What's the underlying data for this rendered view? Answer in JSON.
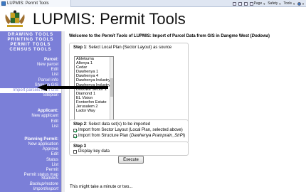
{
  "browser": {
    "tab_title": "LUPMIS: Permit Tools",
    "toolbar": [
      {
        "label": "Page",
        "icon": "page-icon"
      },
      {
        "label": "Safety",
        "icon": "safety-icon"
      },
      {
        "label": "Tools",
        "icon": "tools-icon"
      },
      {
        "label": "",
        "icon": "help-icon"
      }
    ]
  },
  "header": {
    "title": "LUPMIS: Permit Tools",
    "logo": "coat-of-arms-logo"
  },
  "sidebar": {
    "tools": [
      "Drawing Tools",
      "Printing Tools",
      "Permit Tools",
      "Census Tools"
    ],
    "sections": [
      {
        "title": "Parcel:",
        "items": [
          "New parcel",
          "Edit",
          "List",
          "Parcel info",
          "Show in GIS",
          "Import parcels from GIS",
          "Siteplan"
        ]
      },
      {
        "title": "Applicant:",
        "items": [
          "New applicant",
          "Edit",
          "List"
        ]
      },
      {
        "title": "Planning Permit:",
        "items": [
          "New application",
          "Approve",
          "Edit",
          "Status",
          "List",
          "Permit",
          "Permit status map"
        ]
      }
    ],
    "bottom_items": [
      "Statistics",
      "Backup/restore",
      "Import/export"
    ],
    "active_item": "Import parcels from GIS"
  },
  "content": {
    "welcome_prefix": "Welcome to the ",
    "welcome_em1": "Permit Tools",
    "welcome_mid": " of LUPMIS: Import of Parcel Data from GIS in Dangme West (",
    "welcome_em2": "Dodowa",
    "welcome_suffix": ")",
    "step1": {
      "label": "Step 1",
      "text": ": Select Local Plan (Sector Layout) as source",
      "options": [
        "Ablekuma",
        "Allenya 1",
        "Cedar",
        "Dawhenya 1",
        "Dawhenya 4",
        "Dawhenya Industry",
        "Dawhenya Industry",
        "Dodowa Sector 1",
        "Diamond 1",
        "EL Vision",
        "Fontonfon Estate",
        "Jerusalem 2",
        "Lador Way"
      ]
    },
    "step2": {
      "label": "Step 2",
      "text": ": Select data set(s) to be imported",
      "check1": "Import from Sector Layout (Local Plan, selected above)",
      "check2_prefix": "Import from Structure Plan (",
      "check2_em": "Dawhenya Pramprain_StrPl",
      "check2_suffix": ")"
    },
    "step3": {
      "label": "Step 3",
      "check": "Display key data"
    },
    "execute_label": "Execute",
    "note": "This might take a minute or two..."
  },
  "colors": {
    "sidebar_bg": "#7b7fd8",
    "sidebar_text": "#ffffff",
    "check_mark": "#00aa44"
  }
}
